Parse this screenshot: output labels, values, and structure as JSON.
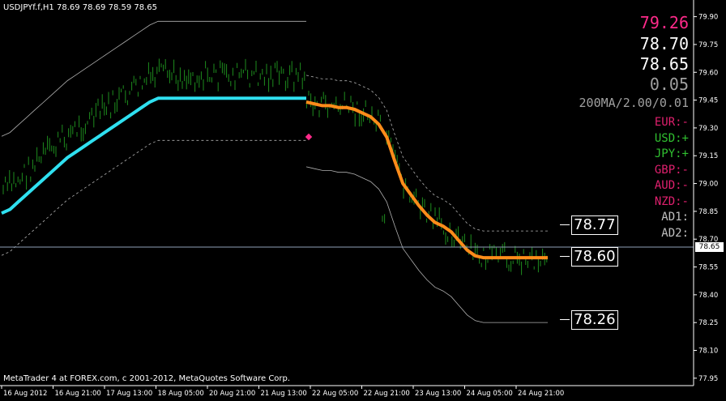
{
  "header": {
    "symbol_info": "USDJPYf.f,H1  78.69 78.69 78.59 78.65"
  },
  "footer": {
    "copyright": "MetaTrader 4 at FOREX.com, c 2001-2012, MetaQuotes Software Corp."
  },
  "indicator": {
    "value1": "79.26",
    "value2": "78.70",
    "value3": "78.65",
    "value4": "0.05",
    "ma_label": "200MA/2.00/0.01",
    "currencies": [
      {
        "label": "EUR:-",
        "color": "#e0206e"
      },
      {
        "label": "USD:+",
        "color": "#30c030"
      },
      {
        "label": "JPY:+",
        "color": "#30c030"
      },
      {
        "label": "GBP:-",
        "color": "#e0206e"
      },
      {
        "label": "AUD:-",
        "color": "#e0206e"
      },
      {
        "label": "NZD:-",
        "color": "#e0206e"
      },
      {
        "label": "AD1:",
        "color": "#c0c0c0"
      },
      {
        "label": "AD2:",
        "color": "#c0c0c0"
      }
    ]
  },
  "levels": {
    "upper": "78.77",
    "mid": "78.60",
    "lower": "78.26"
  },
  "current_price_tag": "78.65",
  "colors": {
    "bars": "#1e8c1e",
    "ma_rising": "#2fe0f0",
    "ma_falling": "#ff8c1a",
    "band": "#b0b0b0",
    "marker": "#ff2a8a"
  },
  "chart_data": {
    "type": "line",
    "ylim": [
      77.91,
      79.99
    ],
    "y_ticks": [
      "79.90",
      "79.75",
      "79.60",
      "79.45",
      "79.30",
      "79.15",
      "79.00",
      "78.85",
      "78.70",
      "78.55",
      "78.40",
      "78.25",
      "78.10",
      "77.95"
    ],
    "x_ticks": [
      "16 Aug 2012",
      "16 Aug 21:00",
      "17 Aug 13:00",
      "18 Aug 05:00",
      "20 Aug 21:00",
      "21 Aug 13:00",
      "22 Aug 05:00",
      "22 Aug 21:00",
      "23 Aug 13:00",
      "24 Aug 05:00",
      "24 Aug 21:00"
    ],
    "current_price": 78.65,
    "series": [
      {
        "values": [
          78.84,
          78.86,
          78.9,
          78.94,
          78.98,
          79.02,
          79.06,
          79.1,
          79.14,
          79.17,
          79.2,
          79.23,
          79.26,
          79.29,
          79.32,
          79.35,
          79.38,
          79.41,
          79.44,
          79.46,
          79.46,
          79.46,
          79.46,
          79.46,
          79.46,
          79.46,
          79.46,
          79.46,
          79.46,
          79.46,
          79.46,
          79.46,
          79.46,
          79.46,
          79.46,
          79.46,
          79.46,
          79.46
        ]
      },
      {
        "values": [
          79.44,
          79.43,
          79.42,
          79.42,
          79.41,
          79.41,
          79.4,
          79.38,
          79.36,
          79.32,
          79.25,
          79.12,
          79.0,
          78.94,
          78.88,
          78.83,
          78.79,
          78.77,
          78.74,
          78.69,
          78.64,
          78.61,
          78.6,
          78.6,
          78.6,
          78.6,
          78.6,
          78.6,
          78.6,
          78.6,
          78.6
        ]
      }
    ]
  }
}
